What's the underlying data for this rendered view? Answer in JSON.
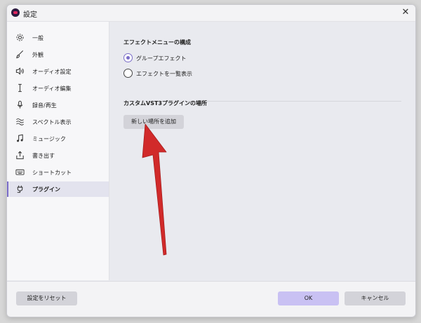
{
  "window": {
    "title": "設定",
    "close_icon": "close-icon"
  },
  "sidebar": {
    "items": [
      {
        "label": "一般",
        "icon": "gear-icon"
      },
      {
        "label": "外観",
        "icon": "brush-icon"
      },
      {
        "label": "オーディオ設定",
        "icon": "speaker-icon"
      },
      {
        "label": "オーディオ編集",
        "icon": "text-cursor-icon"
      },
      {
        "label": "録音/再生",
        "icon": "microphone-icon"
      },
      {
        "label": "スペクトル表示",
        "icon": "spectrum-icon"
      },
      {
        "label": "ミュージック",
        "icon": "music-note-icon"
      },
      {
        "label": "書き出す",
        "icon": "export-icon"
      },
      {
        "label": "ショートカット",
        "icon": "keyboard-icon"
      },
      {
        "label": "プラグイン",
        "icon": "plug-icon",
        "active": true
      }
    ]
  },
  "main": {
    "effects_menu_title": "エフェクトメニューの構成",
    "radio_group_effects": "グループエフェクト",
    "radio_list_effects": "エフェクトを一覧表示",
    "selected_option": "グループエフェクト",
    "vst3_title": "カスタムVST3プラグインの場所",
    "add_location_button": "新しい場所を追加"
  },
  "footer": {
    "reset_button": "設定をリセット",
    "ok_button": "OK",
    "cancel_button": "キャンセル"
  },
  "colors": {
    "accent": "#7a6cc8",
    "primary_button": "#c9c1f3",
    "annotation_arrow": "#d12a2a"
  }
}
